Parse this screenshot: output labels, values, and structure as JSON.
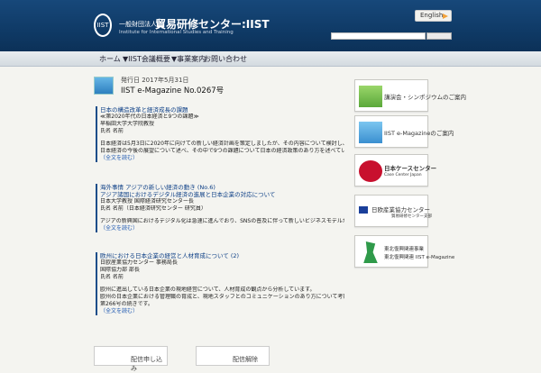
{
  "header": {
    "logo": "IIST",
    "org_type": "一般財団法人",
    "org_name": "貿易研修センター:IIST",
    "org_sub": "Institute for International Studies and Training",
    "lang": "English"
  },
  "nav": {
    "items": [
      "ホーム",
      "▼IIST会議概要",
      "▼事業案内",
      "お問い合わせ"
    ]
  },
  "issue": {
    "date": "発行日 2017年5月31日",
    "title": "IIST e-Magazine No.0267号"
  },
  "articles": [
    {
      "head": "日本の構造改革と経済成長の課題",
      "lines": [
        "≪第2020年代の日本経済と9つの課題≫",
        "早稲田大学大学院教授",
        "氏名 名前",
        "",
        "日本経済は5月3日に2020年に向けての新しい経済計画を策定しましたが、その内容について検討し、今後の日本経済に関する9つの課題を提示しています。",
        "日本経済の今後の展望について述べ、その中で9つの課題について日本の経済政策のあり方を述べています。"
      ],
      "link": "（全文を読む）"
    },
    {
      "head": "海外事情 アジアの新しい経済の動き (No.6)",
      "lines": [
        "アジア諸国におけるデジタル経済の進展と日本企業の対応について",
        "日本大学教授 国際経済研究センター長",
        "氏名 名前（日本経済研究センター 研究員）",
        "",
        "アジアの新興国におけるデジタル化は急速に進んでおり、SNSの普及に伴って新しいビジネスモデルが生まれています。日本企業はこの変化への対応が求められています。"
      ],
      "link": "（全文を読む）"
    },
    {
      "head": "欧州における日本企業の経営と人材育成について (2)",
      "lines": [
        "日欧産業協力センター 事務局長",
        "国際協力部 部長",
        "氏名 名前",
        "",
        "欧州に進出している日本企業の現地経営について、人材育成の観点から分析しています。",
        "欧州の日本企業における管理職の育成と、現地スタッフとのコミュニケーションのあり方について考察しています。",
        "第266号の続きです。"
      ],
      "link": "（全文を読む）"
    }
  ],
  "sidebar": [
    {
      "label": "講演会・シンポジウムのご案内"
    },
    {
      "label": "IIST e-Magazineのご案内"
    },
    {
      "label": "日本ケースセンター",
      "sub": "Case Center Japan"
    },
    {
      "label": "日欧産業協力センター",
      "sub": "貿易研修センター支部"
    },
    {
      "label": "東北復興関連事業",
      "sub": "東北復興関連 IIST e-Magazine"
    }
  ],
  "bottom": {
    "subscribe": "配信申し込み",
    "unsubscribe": "配信解除"
  },
  "colors": {
    "header": "#0f3a66",
    "accent": "#1c4e8a",
    "link": "#1d57b0"
  }
}
